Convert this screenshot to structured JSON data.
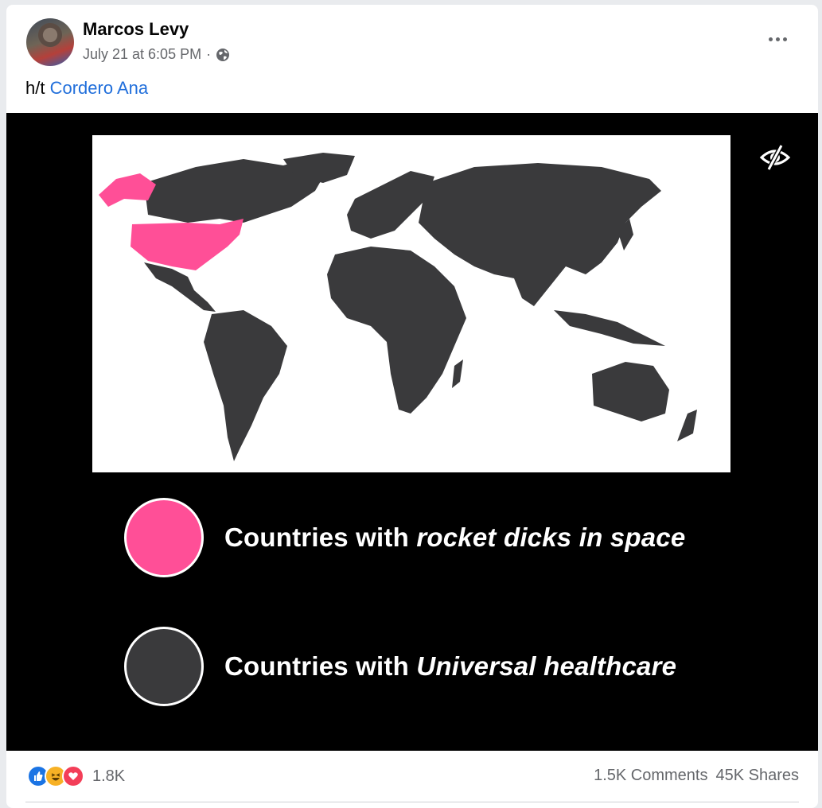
{
  "post": {
    "author": "Marcos Levy",
    "timestamp": "July 21 at 6:05 PM",
    "separator": "·",
    "privacy_icon": "globe-icon",
    "more_icon": "more-options-icon",
    "caption_prefix": "h/t ",
    "caption_link": "Cordero Ana"
  },
  "media": {
    "hide_icon": "eye-slash-icon",
    "legend": [
      {
        "prefix": "Countries with ",
        "emphasis": "rocket dicks in space",
        "color": "#ff4f97"
      },
      {
        "prefix": "Countries with ",
        "emphasis": "Universal healthcare",
        "color": "#3a3a3c"
      }
    ]
  },
  "footer": {
    "reactions": [
      "like-icon",
      "haha-icon",
      "love-icon"
    ],
    "reaction_count": "1.8K",
    "comments": "1.5K Comments",
    "shares": "45K Shares"
  },
  "colors": {
    "link": "#216fdb",
    "pink": "#ff4f97",
    "land": "#3a3a3c"
  }
}
